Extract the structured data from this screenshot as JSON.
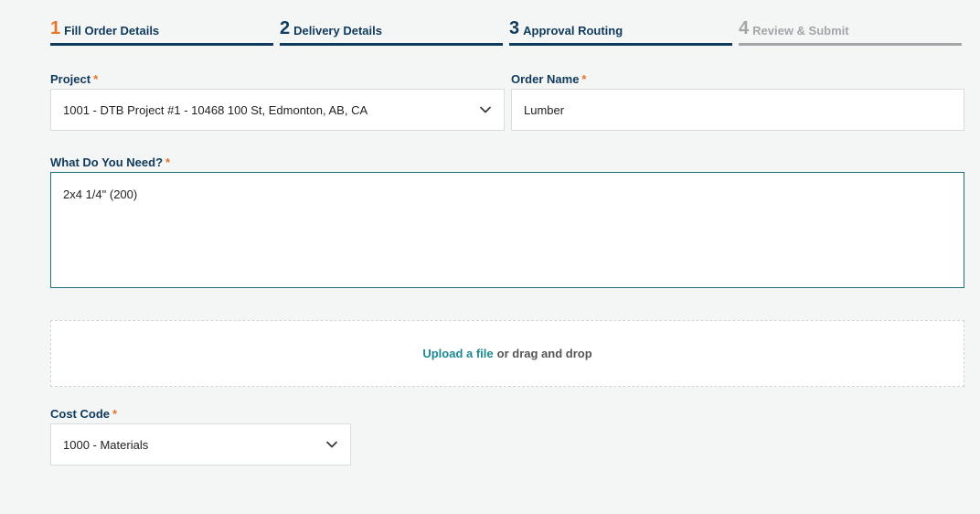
{
  "stepper": {
    "steps": [
      {
        "number": "1",
        "label": "Fill Order Details",
        "state": "active"
      },
      {
        "number": "2",
        "label": "Delivery Details",
        "state": "upcoming"
      },
      {
        "number": "3",
        "label": "Approval Routing",
        "state": "upcoming"
      },
      {
        "number": "4",
        "label": "Review & Submit",
        "state": "disabled"
      }
    ]
  },
  "form": {
    "required_marker": "*",
    "project": {
      "label": "Project",
      "value": "1001 - DTB Project #1 - 10468 100 St, Edmonton, AB, CA"
    },
    "order_name": {
      "label": "Order Name",
      "value": "Lumber"
    },
    "needs": {
      "label": "What Do You Need?",
      "value": "2x4 1/4\" (200)"
    },
    "upload": {
      "link_text": "Upload a file",
      "rest_text": "or drag and drop"
    },
    "cost_code": {
      "label": "Cost Code",
      "value": "1000 - Materials"
    }
  },
  "colors": {
    "primary": "#0f3a5c",
    "accent": "#e8742a",
    "link": "#1b8a94",
    "disabled": "#a3a6a8"
  }
}
